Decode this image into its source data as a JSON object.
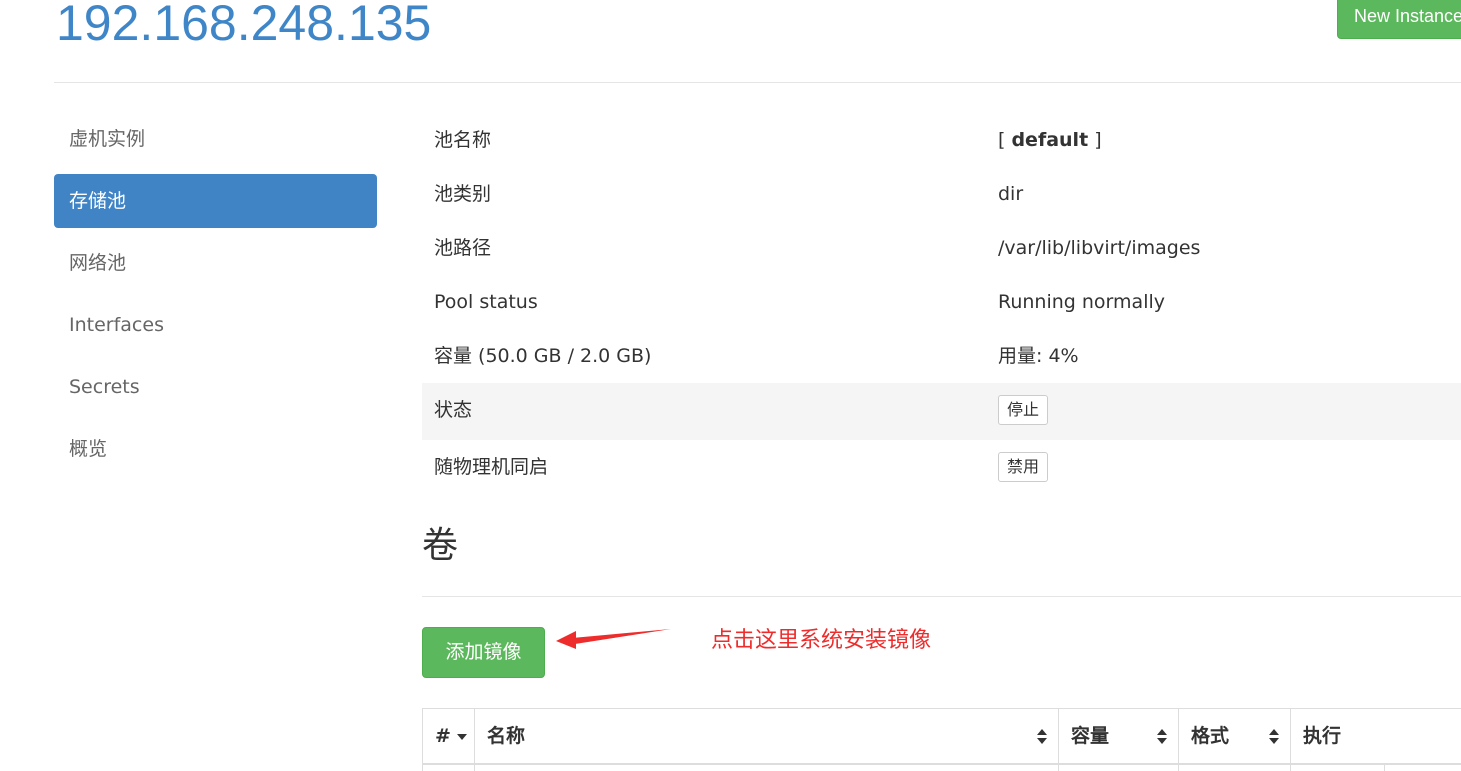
{
  "header": {
    "host": "192.168.248.135",
    "new_instance_label": "New Instance"
  },
  "sidebar": {
    "items": [
      {
        "label": "虚机实例",
        "active": false
      },
      {
        "label": "存储池",
        "active": true
      },
      {
        "label": "网络池",
        "active": false
      },
      {
        "label": "Interfaces",
        "active": false
      },
      {
        "label": "Secrets",
        "active": false
      },
      {
        "label": "概览",
        "active": false
      }
    ]
  },
  "pool": {
    "name_label": "池名称",
    "name_value_open": "[ ",
    "name_value": "default",
    "name_value_close": " ]",
    "type_label": "池类别",
    "type_value": "dir",
    "path_label": "池路径",
    "path_value": "/var/lib/libvirt/images",
    "status_label": "Pool status",
    "status_value": "Running normally",
    "capacity_label": "容量 (50.0 GB / 2.0 GB)",
    "usage_value": "用量: 4%",
    "state_label": "状态",
    "stop_button": "停止",
    "autostart_label": "随物理机同启",
    "disable_button": "禁用"
  },
  "volumes": {
    "heading": "卷",
    "add_image_button": "添加镜像",
    "annotation": "点击这里系统安装镜像",
    "columns": [
      "#",
      "名称",
      "容量",
      "格式",
      "执行"
    ]
  },
  "colors": {
    "link_blue": "#3f86c8",
    "active_blue": "#4084c6",
    "success_green": "#5cb85c",
    "annotation_red": "#ee2c2c"
  }
}
